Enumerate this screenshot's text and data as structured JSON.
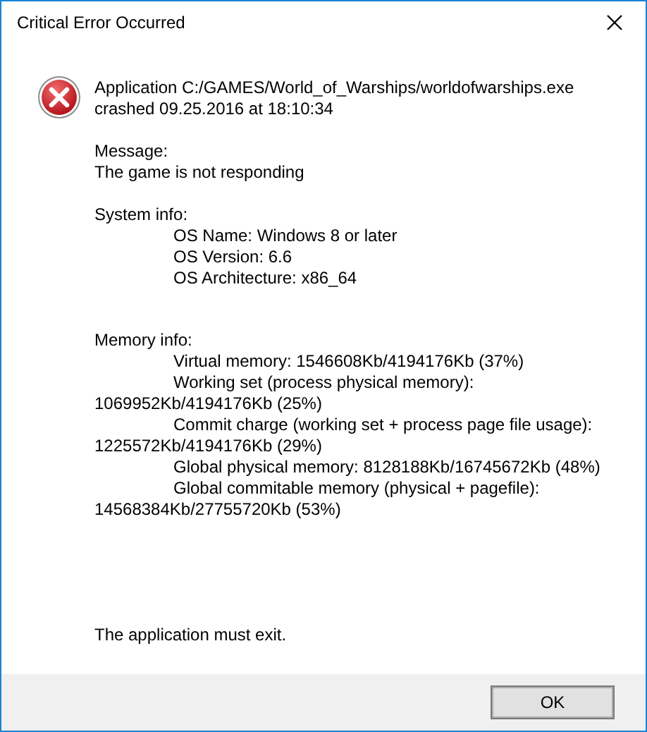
{
  "window": {
    "title": "Critical Error Occurred"
  },
  "header": [
    "Application C:/GAMES/World_of_Warships/worldofwarships.exe",
    "crashed 09.25.2016 at 18:10:34"
  ],
  "sections": [
    {
      "heading": "Message:",
      "lines": [
        {
          "kind": "plain",
          "text": "The game is not responding"
        }
      ]
    },
    {
      "heading": "System info:",
      "lines": [
        {
          "kind": "indented",
          "text": "OS Name: Windows 8 or later"
        },
        {
          "kind": "indented",
          "text": "OS Version: 6.6"
        },
        {
          "kind": "indented",
          "text": "OS Architecture: x86_64"
        }
      ]
    },
    {
      "heading": "Memory info:",
      "lines": [
        {
          "kind": "indented",
          "text": "Virtual memory: 1546608Kb/4194176Kb (37%)"
        },
        {
          "kind": "indented",
          "text": "Working set (process physical memory):"
        },
        {
          "kind": "plain",
          "text": "1069952Kb/4194176Kb (25%)"
        },
        {
          "kind": "indented",
          "text": "Commit charge (working set + process page file usage):"
        },
        {
          "kind": "plain",
          "text": "1225572Kb/4194176Kb (29%)"
        },
        {
          "kind": "indented",
          "text": "Global physical memory: 8128188Kb/16745672Kb (48%)"
        },
        {
          "kind": "indented",
          "text": "Global commitable memory (physical + pagefile):"
        },
        {
          "kind": "plain",
          "text": "14568384Kb/27755720Kb (53%)"
        }
      ]
    }
  ],
  "footer_message": "The application must exit.",
  "buttons": [
    "OK"
  ]
}
